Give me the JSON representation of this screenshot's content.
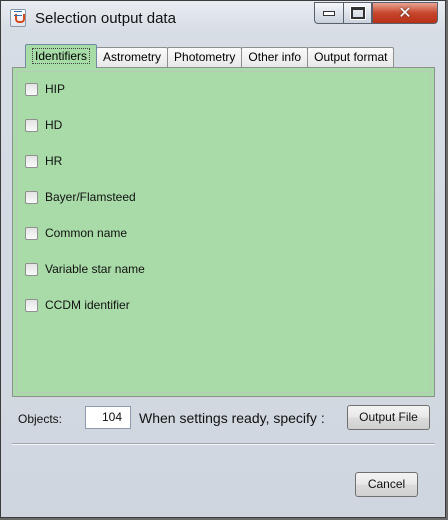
{
  "window": {
    "title": "Selection output data",
    "controls": {
      "minimize": "minimize",
      "maximize": "maximize",
      "close": "✕"
    }
  },
  "tabs": [
    {
      "label": "Identifiers",
      "active": true
    },
    {
      "label": "Astrometry",
      "active": false
    },
    {
      "label": "Photometry",
      "active": false
    },
    {
      "label": "Other info",
      "active": false
    },
    {
      "label": "Output format",
      "active": false
    }
  ],
  "identifiers": [
    {
      "label": "HIP",
      "checked": false
    },
    {
      "label": "HD",
      "checked": false
    },
    {
      "label": "HR",
      "checked": false
    },
    {
      "label": "Bayer/Flamsteed",
      "checked": false
    },
    {
      "label": "Common name",
      "checked": false
    },
    {
      "label": "Variable star name",
      "checked": false
    },
    {
      "label": "CCDM identifier",
      "checked": false
    }
  ],
  "footer": {
    "objects_label": "Objects:",
    "objects_value": "104",
    "settings_text": "When settings ready, specify :",
    "output_file_button": "Output File",
    "cancel_button": "Cancel"
  },
  "colors": {
    "panel_background": "#a9dba8",
    "close_button": "#c7462c"
  }
}
